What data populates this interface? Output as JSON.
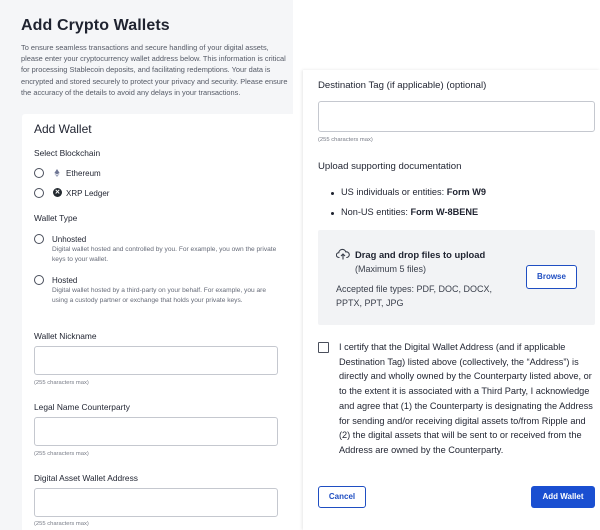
{
  "page": {
    "title": "Add Crypto Wallets",
    "intro": "To ensure seamless transactions and secure handling of your digital assets, please enter your cryptocurrency wallet address below. This information is critical for processing Stablecoin deposits, and facilitating redemptions. Your data is encrypted and stored securely to protect your privacy and security. Please ensure the accuracy of the details to avoid any delays in your transactions."
  },
  "left_form": {
    "heading": "Add Wallet",
    "blockchain": {
      "label": "Select Blockchain",
      "options": [
        {
          "label": "Ethereum",
          "icon": "ethereum-icon"
        },
        {
          "label": "XRP Ledger",
          "icon": "xrp-icon"
        }
      ]
    },
    "wallet_type": {
      "label": "Wallet Type",
      "options": [
        {
          "label": "Unhosted",
          "description": "Digital wallet hosted and controlled by you. For example, you own the private keys to your wallet."
        },
        {
          "label": "Hosted",
          "description": "Digital wallet hosted by a third-party on your behalf. For example, you are using a custody partner or exchange that holds your private keys."
        }
      ]
    },
    "nickname": {
      "label": "Wallet Nickname",
      "value": "",
      "hint": "(255 characters max)"
    },
    "counterparty": {
      "label": "Legal Name Counterparty",
      "value": "",
      "hint": "(255 characters max)"
    },
    "wallet_address": {
      "label": "Digital Asset Wallet Address",
      "hint": "(255 characters max)"
    }
  },
  "right_form": {
    "destination_tag": {
      "label": "Destination Tag (if applicable) (optional)",
      "value": "",
      "hint": "(255 characters max)"
    },
    "upload": {
      "label": "Upload supporting documentation",
      "bullets": [
        {
          "text": "US individuals or entities: ",
          "bold": "Form W9"
        },
        {
          "text": "Non-US entities: ",
          "bold": "Form W-8BENE"
        }
      ],
      "dropzone_title": "Drag and drop files to upload",
      "dropzone_sub": "(Maximum 5 files)",
      "accepted": "Accepted file types: PDF, DOC, DOCX, PPTX, PPT, JPG",
      "browse_label": "Browse"
    },
    "certify_text": "I certify that the Digital Wallet Address (and if applicable Destination Tag) listed above (collectively, the “Address”) is directly and wholly owned by the Counterparty listed above, or to the extent it is associated with a Third Party, I acknowledge and agree that (1) the Counterparty is designating the Address for sending and/or receiving digital assets to/from Ripple and (2) the digital assets that will be sent to or received from the Address are owned by the Counterparty.",
    "cancel_label": "Cancel",
    "submit_label": "Add Wallet"
  },
  "colors": {
    "accent": "#1a4fd1",
    "background": "#f5f6f8",
    "text": "#1f2330"
  }
}
